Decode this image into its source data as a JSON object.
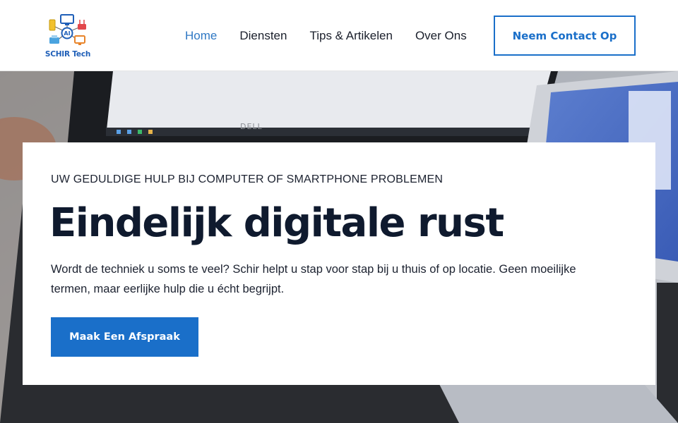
{
  "brand": {
    "name": "SCHIR Tech",
    "logo_badge": "AI",
    "colors": {
      "primary": "#1a6fc9",
      "nav_active": "#2f78c4",
      "text_dark": "#0f1a2e"
    }
  },
  "nav": {
    "items": [
      {
        "label": "Home",
        "active": true
      },
      {
        "label": "Diensten",
        "active": false
      },
      {
        "label": "Tips & Artikelen",
        "active": false
      },
      {
        "label": "Over Ons",
        "active": false
      }
    ],
    "contact_label": "Neem Contact Op"
  },
  "hero": {
    "laptop_brand": "DELL",
    "eyebrow": "UW GEDULDIGE HULP BIJ COMPUTER OF SMARTPHONE PROBLEMEN",
    "headline": "Eindelijk digitale rust",
    "body": "Wordt de techniek u soms te veel? Schir helpt u stap voor stap bij u thuis of op locatie. Geen moeilijke termen, maar eerlijke hulp die u écht begrijpt.",
    "cta_label": "Maak Een Afspraak"
  }
}
